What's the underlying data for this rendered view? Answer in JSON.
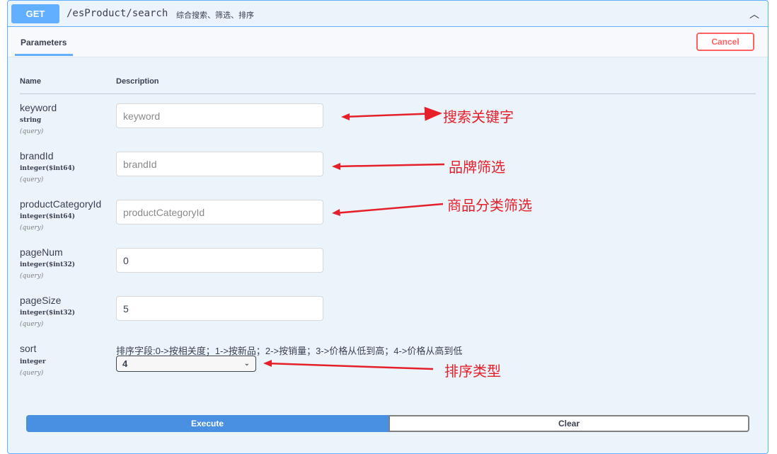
{
  "operation": {
    "method": "GET",
    "path": "/esProduct/search",
    "summary": "综合搜索、筛选、排序"
  },
  "tabs": {
    "parameters": "Parameters",
    "cancel": "Cancel"
  },
  "table": {
    "name_header": "Name",
    "description_header": "Description"
  },
  "params": [
    {
      "name": "keyword",
      "type": "string",
      "in": "(query)",
      "value": "keyword",
      "placeholder": true
    },
    {
      "name": "brandId",
      "type": "integer($int64)",
      "in": "(query)",
      "value": "brandId",
      "placeholder": true
    },
    {
      "name": "productCategoryId",
      "type": "integer($int64)",
      "in": "(query)",
      "value": "productCategoryId",
      "placeholder": true
    },
    {
      "name": "pageNum",
      "type": "integer($int32)",
      "in": "(query)",
      "value": "0",
      "placeholder": false
    },
    {
      "name": "pageSize",
      "type": "integer($int32)",
      "in": "(query)",
      "value": "5",
      "placeholder": false
    },
    {
      "name": "sort",
      "type": "integer",
      "in": "(query)",
      "description": "排序字段:0->按相关度；1->按新品；2->按销量；3->价格从低到高；4->价格从高到低",
      "value": "4"
    }
  ],
  "buttons": {
    "execute": "Execute",
    "clear": "Clear"
  },
  "annotations": [
    "搜索关键字",
    "品牌筛选",
    "商品分类筛选",
    "排序类型"
  ],
  "colors": {
    "get": "#61affe",
    "execute": "#4990e2",
    "cancel": "#ff6060",
    "annotation": "#e5202a"
  }
}
